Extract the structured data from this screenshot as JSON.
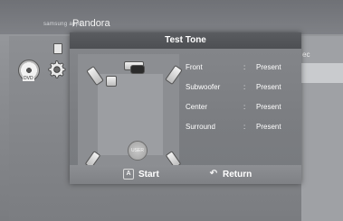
{
  "background": {
    "header_small": "samsung apps",
    "header_title": "Pandora",
    "right_text": "ec",
    "disc_label": "DVD"
  },
  "dialog": {
    "title": "Test Tone",
    "room": {
      "user_label": "USER"
    },
    "channels": [
      {
        "name": "Front",
        "separator": ":",
        "value": "Present"
      },
      {
        "name": "Subwoofer",
        "separator": ":",
        "value": "Present"
      },
      {
        "name": "Center",
        "separator": ":",
        "value": "Present"
      },
      {
        "name": "Surround",
        "separator": ":",
        "value": "Present"
      }
    ],
    "buttons": {
      "start_key": "A",
      "start_label": "Start",
      "return_icon": "↶",
      "return_label": "Return"
    }
  },
  "colors": {
    "dialog_title_bg": "#4d4f53",
    "dialog_body_bg": "#7b7d81",
    "text": "#ffffff"
  },
  "icons": [
    "disc-icon",
    "gear-icon",
    "speaker-icon",
    "return-icon"
  ]
}
